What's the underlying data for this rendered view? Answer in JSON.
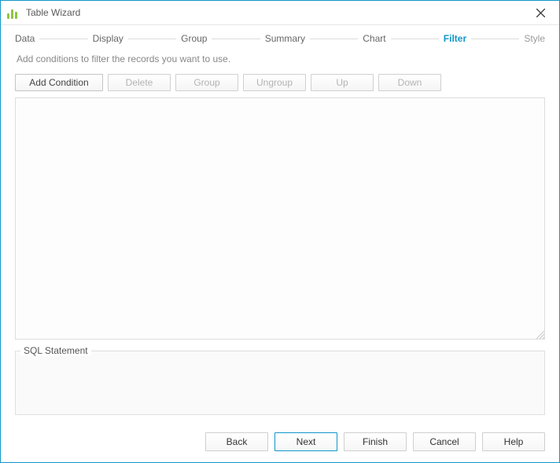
{
  "titlebar": {
    "title": "Table Wizard"
  },
  "steps": {
    "items": [
      {
        "label": "Data"
      },
      {
        "label": "Display"
      },
      {
        "label": "Group"
      },
      {
        "label": "Summary"
      },
      {
        "label": "Chart"
      },
      {
        "label": "Filter"
      },
      {
        "label": "Style"
      }
    ],
    "active_index": 5
  },
  "description": "Add conditions to filter the records you want to use.",
  "toolbar": {
    "add_condition": "Add Condition",
    "delete": "Delete",
    "group": "Group",
    "ungroup": "Ungroup",
    "up": "Up",
    "down": "Down"
  },
  "sql_section": {
    "legend": "SQL Statement",
    "content": ""
  },
  "footer": {
    "back": "Back",
    "next": "Next",
    "finish": "Finish",
    "cancel": "Cancel",
    "help": "Help"
  },
  "colors": {
    "accent": "#1296c8"
  }
}
